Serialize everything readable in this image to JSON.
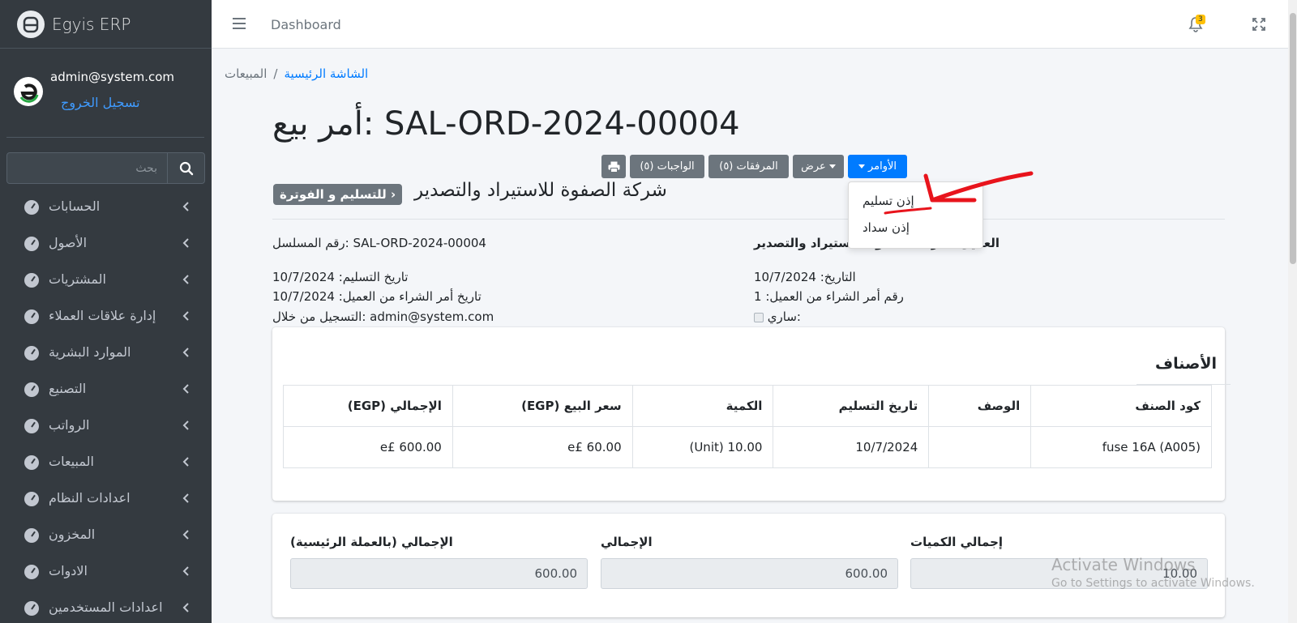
{
  "app": {
    "name": "Egyis ERP"
  },
  "user": {
    "email": "admin@system.com",
    "logout": "تسجيل الخروج"
  },
  "search": {
    "placeholder": "بحث"
  },
  "sidebar": {
    "items": [
      {
        "label": "الحسابات"
      },
      {
        "label": "الأصول"
      },
      {
        "label": "المشتريات"
      },
      {
        "label": "إدارة علاقات العملاء"
      },
      {
        "label": "الموارد البشرية"
      },
      {
        "label": "التصنيع"
      },
      {
        "label": "الرواتب"
      },
      {
        "label": "المبيعات"
      },
      {
        "label": "اعدادات النظام"
      },
      {
        "label": "المخزون"
      },
      {
        "label": "الادوات"
      },
      {
        "label": "اعدادات المستخدمين"
      }
    ]
  },
  "topbar": {
    "title": "Dashboard",
    "notifications": "3"
  },
  "breadcrumb": {
    "home": "الشاشة الرئيسية",
    "current": "المبيعات"
  },
  "order": {
    "title": "أمر بيع: SAL-ORD-2024-00004",
    "customer": "شركة الصفوة للاستيراد والتصدير",
    "status": "للتسليم و الفوترة ›"
  },
  "buttons": {
    "commands": "الأوامر",
    "view": "عرض",
    "attachments": "المرفقات (٥)",
    "duties": "الواجبات (٥)"
  },
  "dropdown": {
    "items": [
      {
        "label": "إذن تسليم"
      },
      {
        "label": "إذن سداد"
      }
    ]
  },
  "details": {
    "serial": "رقم المسلسل: SAL-ORD-2024-00004",
    "customer_partial": "العميل: شركة الصفوة للاستيراد والتصدير",
    "delivery_date": "تاريخ التسليم: 10/7/2024",
    "date": "التاريخ: 10/7/2024",
    "po_date": "تاريخ أمر الشراء من العميل: 10/7/2024",
    "po_no": "رقم أمر الشراء من العميل: 1",
    "registered_by": "التسجيل من خلال: admin@system.com",
    "active": "ساري:"
  },
  "items_tab": {
    "title": "الأصناف"
  },
  "table": {
    "headers": [
      "كود الصنف",
      "الوصف",
      "تاريخ التسليم",
      "الكمية",
      "سعر البيع (EGP)",
      "الإجمالي (EGP)"
    ],
    "rows": [
      [
        "fuse 16A (A005)",
        "",
        "10/7/2024",
        "10.00 (Unit)",
        "e£ 60.00",
        "e£ 600.00"
      ]
    ]
  },
  "totals": {
    "qty_label": "إجمالي الكميات",
    "qty_value": "10.00",
    "total_label": "الإجمالي",
    "total_value": "600.00",
    "base_label": "الإجمالي (بالعملة الرئيسية)",
    "base_value": "600.00"
  },
  "watermark": {
    "line1": "Activate Windows",
    "line2": "Go to Settings to activate Windows."
  },
  "colors": {
    "sidebar": "#343a40",
    "primary": "#007bff",
    "secondary": "#6c757d",
    "annotation": "#e8141c"
  }
}
